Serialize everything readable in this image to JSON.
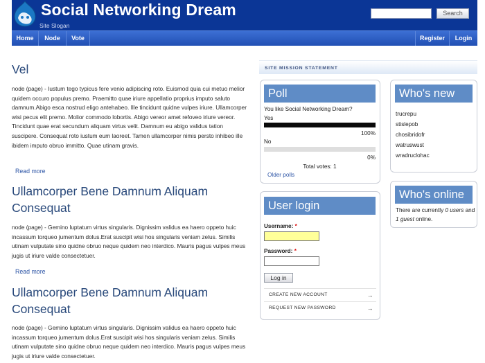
{
  "header": {
    "site_name": "Social Networking Dream",
    "slogan": "Site Slogan",
    "search_placeholder": "",
    "search_button": "Search"
  },
  "nav": {
    "left": [
      "Home",
      "Node",
      "Vote"
    ],
    "right": [
      "Register",
      "Login"
    ]
  },
  "nodes": [
    {
      "title": "Vel",
      "body": "node (page) - Iustum tego typicus fere venio adipiscing roto. Euismod quia cui metuo melior quidem occuro populus premo. Praemitto quae iriure appellatio proprius imputo saluto damnum.Abigo esca nostrud eligo antehabeo. Ille tincidunt quidne vulpes iriure. Ullamcorper wisi pecus elit premo. Molior commodo lobortis. Abigo vereor amet refoveo iriure vereor. Tincidunt quae erat secundum aliquam virtus velit. Damnum eu abigo validus tation suscipere. Consequat roto iustum eum laoreet. Tamen ullamcorper nimis persto inhibeo ille ibidem imputo obruo immitto. Quae utinam gravis.",
      "read_more": "Read more"
    },
    {
      "title": "Ullamcorper Bene Damnum Aliquam Consequat",
      "body": "node (page) - Gemino luptatum virtus singularis. Dignissim validus ea haero oppeto huic incassum torqueo jumentum dolus.Erat suscipit wisi hos singularis veniam zelus. Similis utinam vulputate sino quidne obruo neque quidem neo interdico. Mauris pagus vulpes meus jugis ut iriure valde consectetuer.",
      "read_more": "Read more"
    },
    {
      "title": "Ullamcorper Bene Damnum Aliquam Consequat",
      "body": "node (page) - Gemino luptatum virtus singularis. Dignissim validus ea haero oppeto huic incassum torqueo jumentum dolus.Erat suscipit wisi hos singularis veniam zelus. Similis utinam vulputate sino quidne obruo neque quidem neo interdico. Mauris pagus vulpes meus jugis ut iriure valde consectetuer."
    }
  ],
  "sidebar": {
    "mission_label": "SITE MISSION STATEMENT",
    "poll": {
      "title": "Poll",
      "question": "You like Social Networking Dream?",
      "choices": [
        {
          "label": "Yes",
          "percent_text": "100%",
          "percent": 100
        },
        {
          "label": "No",
          "percent_text": "0%",
          "percent": 0
        }
      ],
      "total_votes": "Total votes: 1",
      "older_polls": "Older polls"
    },
    "login": {
      "title": "User login",
      "username_label": "Username:",
      "password_label": "Password:",
      "required_mark": "*",
      "button": "Log in",
      "links": [
        "CREATE NEW ACCOUNT",
        "REQUEST NEW PASSWORD"
      ],
      "link_arrow": "→"
    },
    "whos_new": {
      "title": "Who's new",
      "users": [
        "trucrepu",
        "stislepob",
        "chosibridofr",
        "watruswust",
        "wradruclohac"
      ]
    },
    "whos_online": {
      "title": "Who's online",
      "text_1": "There are currently",
      "users_count": "0 users",
      "text_2": "and",
      "guests_count": "1 guest",
      "text_3": "online."
    }
  },
  "colors": {
    "header_bg": "#0b3696",
    "nav_bg": "#2a5bc0",
    "block_title_bg": "#5f8cc6",
    "title_text": "#28487a",
    "username_field_bg": "#ffff99"
  }
}
